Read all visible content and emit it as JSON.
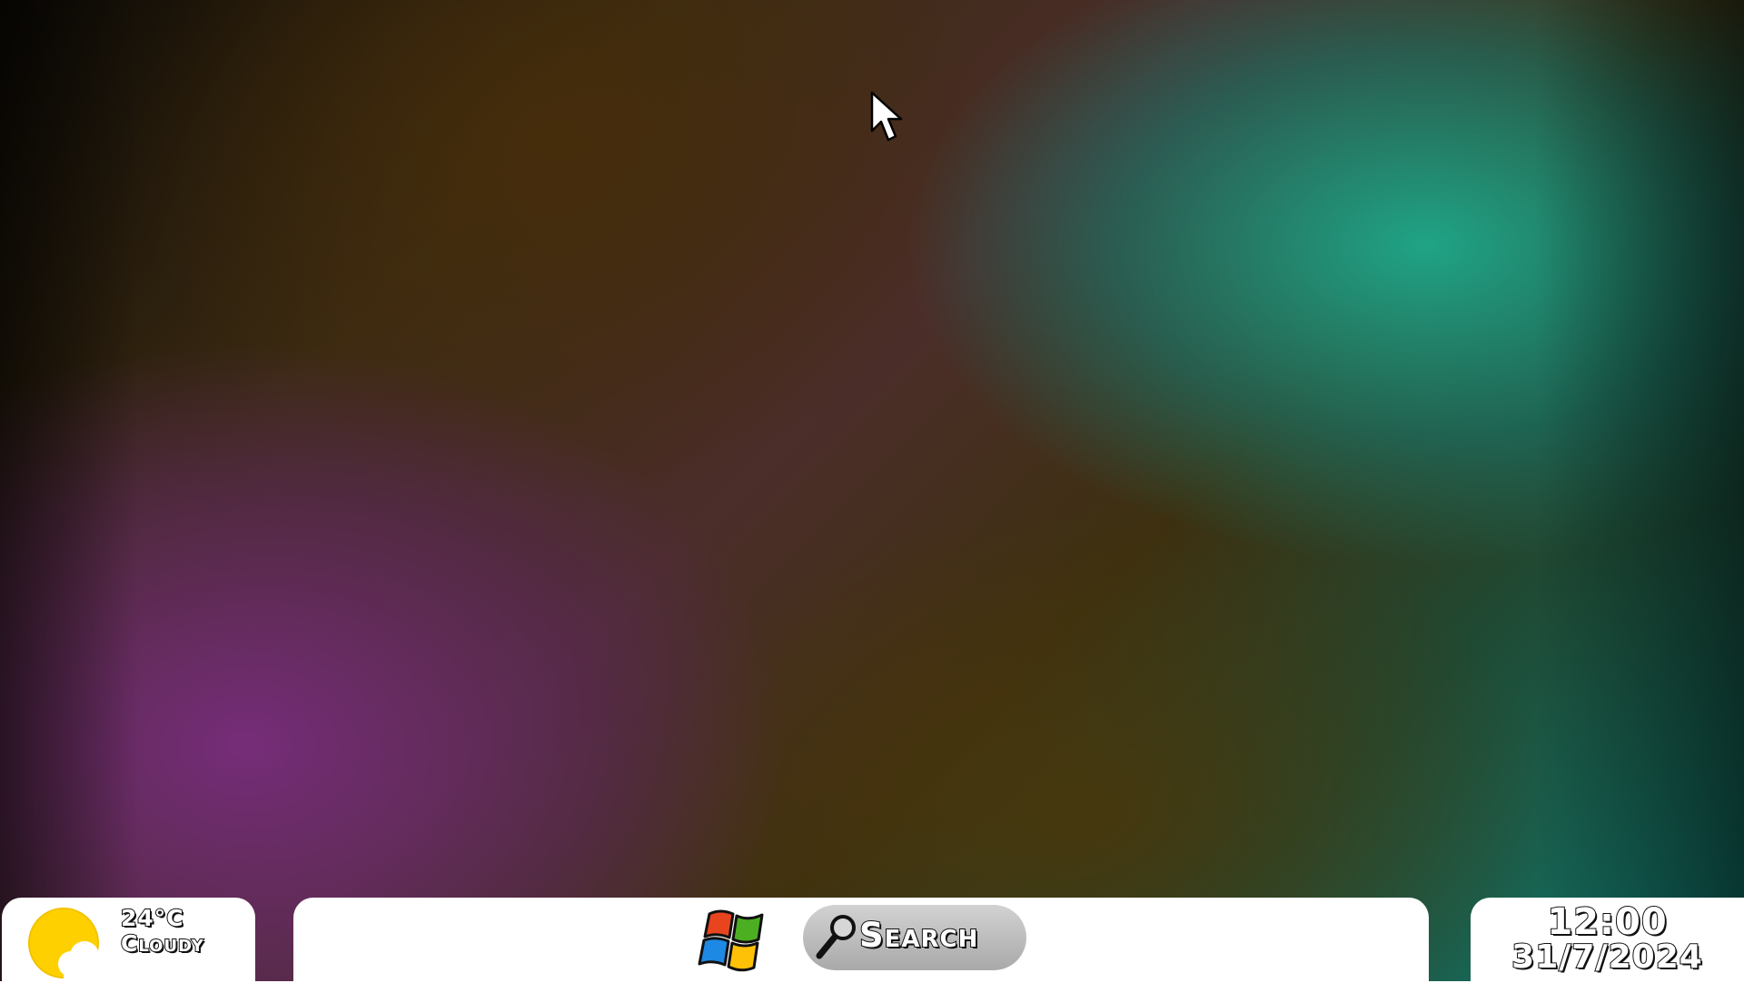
{
  "weather": {
    "temperature": "24°C",
    "condition": "Cloudy",
    "icon": "partly-cloudy-icon",
    "sun_color": "#FFD000"
  },
  "taskbar": {
    "start_icon": "windows-logo-icon",
    "search_label": "Search",
    "search_icon": "magnifier-icon"
  },
  "clock": {
    "time": "12:00",
    "date": "31/7/2024"
  },
  "cursor": {
    "icon": "mouse-pointer-icon"
  }
}
